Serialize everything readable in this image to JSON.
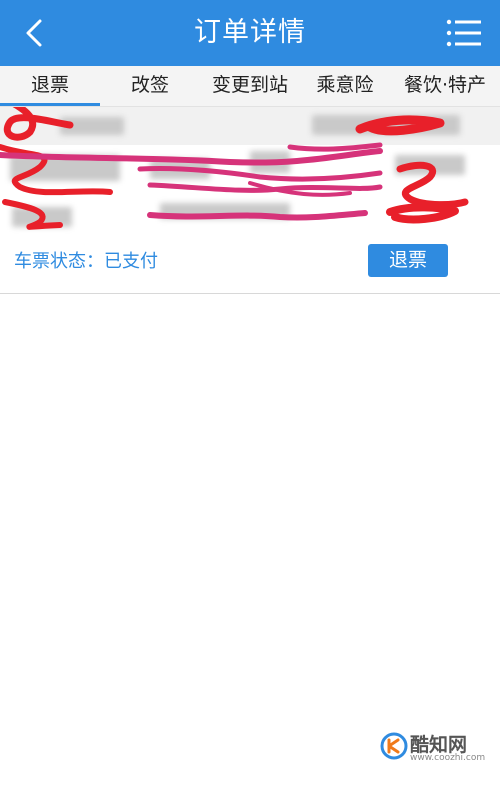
{
  "header": {
    "title": "订单详情",
    "back_icon": "chevron-left-icon",
    "menu_icon": "list-menu-icon"
  },
  "tabs": [
    {
      "label": "退票",
      "active": true
    },
    {
      "label": "改签",
      "active": false
    },
    {
      "label": "变更到站",
      "active": false
    },
    {
      "label": "乘意险",
      "active": false
    },
    {
      "label": "餐饮·特产",
      "active": false
    }
  ],
  "ticket": {
    "status_text": "车票状态：已支付",
    "refund_button_label": "退票"
  },
  "watermark": {
    "name": "酷知网",
    "url": "www.coozhi.com"
  },
  "colors": {
    "primary": "#2f8be0",
    "scribble_red": "#e8202a",
    "scribble_pink": "#d6337a"
  }
}
